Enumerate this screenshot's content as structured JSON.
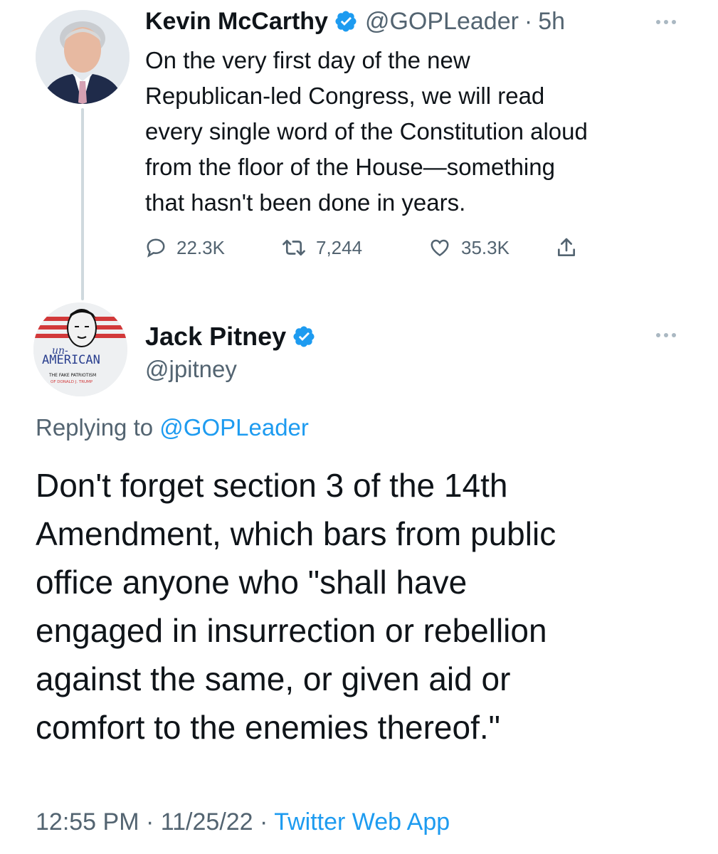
{
  "colors": {
    "text": "#0f1419",
    "secondary": "#536471",
    "accent": "#1d9bf0",
    "thread_line": "#cfd9de"
  },
  "original_tweet": {
    "display_name": "Kevin McCarthy",
    "handle": "@GOPLeader",
    "separator": "·",
    "time": "5h",
    "verified_icon": "verified-badge-icon",
    "more_icon": "more-options-icon",
    "body_lines": [
      "On the very first day of the new",
      "Republican-led Congress, we will read",
      "every single word of the Constitution aloud",
      "from the floor of the House—something",
      "that hasn't been done in years."
    ],
    "actions": {
      "replies": "22.3K",
      "retweets": "7,244",
      "likes": "35.3K",
      "reply_icon": "reply-icon",
      "retweet_icon": "retweet-icon",
      "like_icon": "heart-icon",
      "share_icon": "share-icon"
    }
  },
  "reply_tweet": {
    "display_name": "Jack Pitney",
    "handle": "@jpitney",
    "verified_icon": "verified-badge-icon",
    "more_icon": "more-options-icon",
    "avatar_text": {
      "script": "un-",
      "title": "AMERICAN",
      "subtitle_1": "THE FAKE PATRIOTISM",
      "subtitle_2": "OF DONALD J. TRUMP"
    },
    "replying_prefix": "Replying to",
    "replying_to": "@GOPLeader",
    "body_lines": [
      "Don't forget section 3 of the 14th",
      "Amendment, which bars from public",
      "office anyone who \"shall have",
      "engaged in insurrection or rebellion",
      "against the same, or given aid or",
      "comfort to the enemies thereof.\""
    ],
    "time": "12:55 PM",
    "date": "11/25/22",
    "separator": "·",
    "source": "Twitter Web App"
  }
}
